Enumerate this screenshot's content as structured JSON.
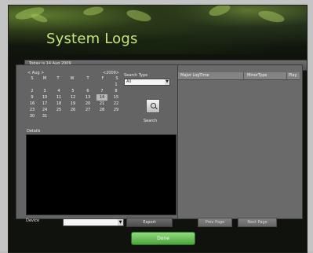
{
  "header": {
    "title": "System Logs"
  },
  "status_bar": {
    "text": "Today is 14 Aug 2009"
  },
  "calendar": {
    "month": "< Aug >",
    "year": "<2009>",
    "weekdays": [
      "S",
      "M",
      "T",
      "W",
      "T",
      "F",
      "S"
    ],
    "weeks": [
      [
        "",
        "",
        "",
        "",
        "",
        "",
        "1"
      ],
      [
        "2",
        "3",
        "4",
        "5",
        "6",
        "7",
        "8"
      ],
      [
        "9",
        "10",
        "11",
        "12",
        "13",
        "14",
        "15"
      ],
      [
        "16",
        "17",
        "18",
        "19",
        "20",
        "21",
        "22"
      ],
      [
        "23",
        "24",
        "25",
        "26",
        "27",
        "28",
        "29"
      ],
      [
        "30",
        "31",
        "",
        "",
        "",
        "",
        ""
      ]
    ],
    "selected_day": "14"
  },
  "search": {
    "type_label": "Search Type",
    "type_value": "All",
    "button_label": "Search"
  },
  "details": {
    "label": "Details"
  },
  "table": {
    "headers": [
      "Major LogTime",
      "MinorType",
      "Play"
    ]
  },
  "device": {
    "label": "Device",
    "value": ""
  },
  "buttons": {
    "export": "Export",
    "prev_page": "Prev Page",
    "next_page": "Next Page",
    "done": "Done"
  }
}
